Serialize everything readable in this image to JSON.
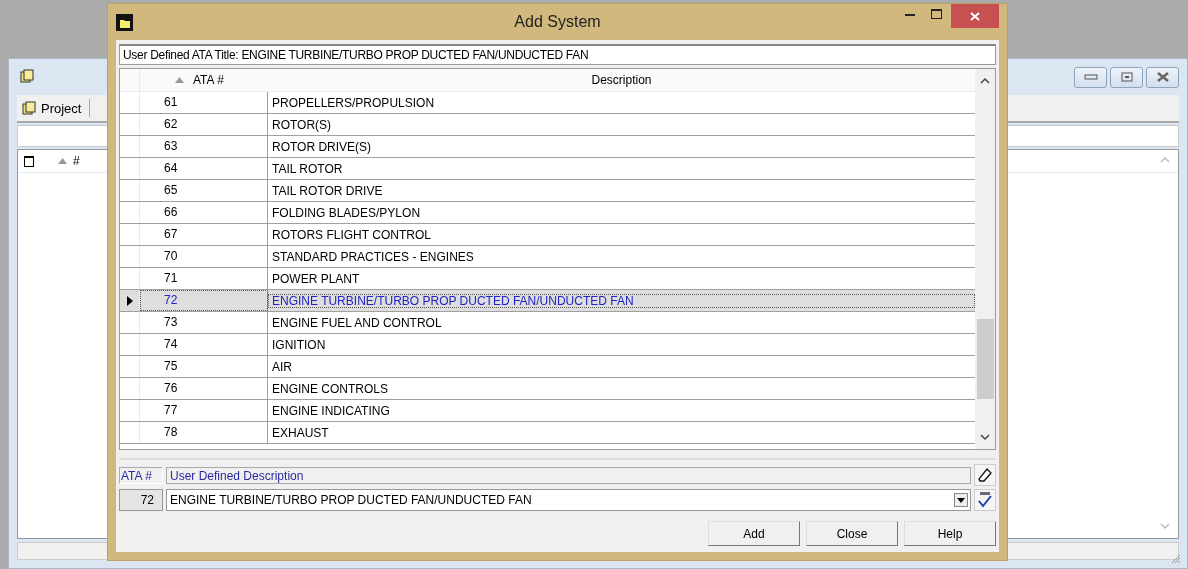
{
  "background_window": {
    "toolbar": [
      {
        "label": "Project"
      }
    ],
    "list": {
      "checked": false,
      "columns": [
        "#"
      ]
    }
  },
  "dialog": {
    "title": "Add System",
    "ata_title": "User Defined ATA Title: ENGINE TURBINE/TURBO PROP DUCTED FAN/UNDUCTED FAN",
    "table": {
      "columns": [
        "ATA #",
        "Description"
      ],
      "rows": [
        {
          "ata": "61",
          "description": "PROPELLERS/PROPULSION",
          "selected": false
        },
        {
          "ata": "62",
          "description": "ROTOR(S)",
          "selected": false
        },
        {
          "ata": "63",
          "description": "ROTOR DRIVE(S)",
          "selected": false
        },
        {
          "ata": "64",
          "description": "TAIL ROTOR",
          "selected": false
        },
        {
          "ata": "65",
          "description": "TAIL ROTOR DRIVE",
          "selected": false
        },
        {
          "ata": "66",
          "description": "FOLDING BLADES/PYLON",
          "selected": false
        },
        {
          "ata": "67",
          "description": "ROTORS FLIGHT CONTROL",
          "selected": false
        },
        {
          "ata": "70",
          "description": "STANDARD PRACTICES - ENGINES",
          "selected": false
        },
        {
          "ata": "71",
          "description": "POWER PLANT",
          "selected": false
        },
        {
          "ata": "72",
          "description": "ENGINE TURBINE/TURBO PROP DUCTED FAN/UNDUCTED FAN",
          "selected": true
        },
        {
          "ata": "73",
          "description": "ENGINE FUEL AND CONTROL",
          "selected": false
        },
        {
          "ata": "74",
          "description": "IGNITION",
          "selected": false
        },
        {
          "ata": "75",
          "description": "AIR",
          "selected": false
        },
        {
          "ata": "76",
          "description": "ENGINE CONTROLS",
          "selected": false
        },
        {
          "ata": "77",
          "description": "ENGINE INDICATING",
          "selected": false
        },
        {
          "ata": "78",
          "description": "EXHAUST",
          "selected": false
        }
      ]
    },
    "editor": {
      "ata_label": "ATA #",
      "description_label": "User Defined Description",
      "ata_value": "72",
      "description_value": "ENGINE TURBINE/TURBO PROP DUCTED FAN/UNDUCTED FAN"
    },
    "buttons": [
      {
        "label": "Add"
      },
      {
        "label": "Close"
      },
      {
        "label": "Help"
      }
    ]
  }
}
